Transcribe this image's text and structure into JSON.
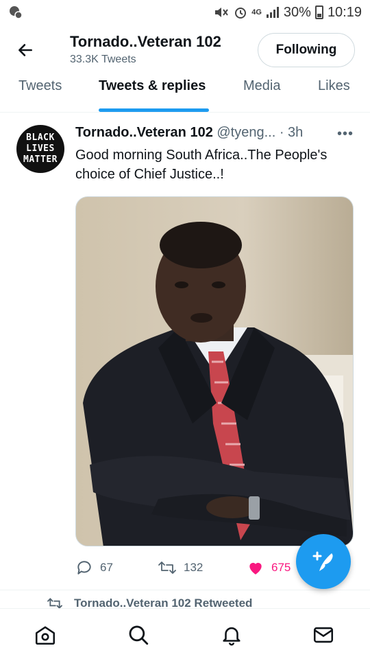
{
  "status_bar": {
    "network": "4G",
    "battery": "30%",
    "time": "10:19"
  },
  "header": {
    "profile_name": "Tornado..Veteran 102",
    "tweet_count": "33.3K Tweets",
    "follow_label": "Following"
  },
  "tabs": [
    {
      "label": "Tweets",
      "active": false
    },
    {
      "label": "Tweets & replies",
      "active": true
    },
    {
      "label": "Media",
      "active": false
    },
    {
      "label": "Likes",
      "active": false
    }
  ],
  "tweet": {
    "avatar_text": [
      "BLACK",
      "LIVES",
      "MATTER"
    ],
    "author_name": "Tornado..Veteran 102",
    "handle": "@tyeng...",
    "time": "· 3h",
    "more": "•••",
    "text": "Good morning South Africa..The People's choice of Chief Justice..!",
    "media_alt": "photo of a man in a dark suit with arms crossed",
    "replies": "67",
    "retweets": "132",
    "likes": "675",
    "liked": true
  },
  "next_item": {
    "retweet_label": "Tornado..Veteran 102 Retweeted"
  },
  "colors": {
    "accent": "#1d9bf0",
    "like": "#f91880",
    "muted": "#536471"
  },
  "icons": {
    "back": "arrow-left-icon",
    "reply": "comment-icon",
    "retweet": "retweet-icon",
    "like": "heart-icon",
    "compose": "feather-plus-icon",
    "nav": [
      "home-icon",
      "search-icon",
      "bell-icon",
      "mail-icon"
    ]
  }
}
